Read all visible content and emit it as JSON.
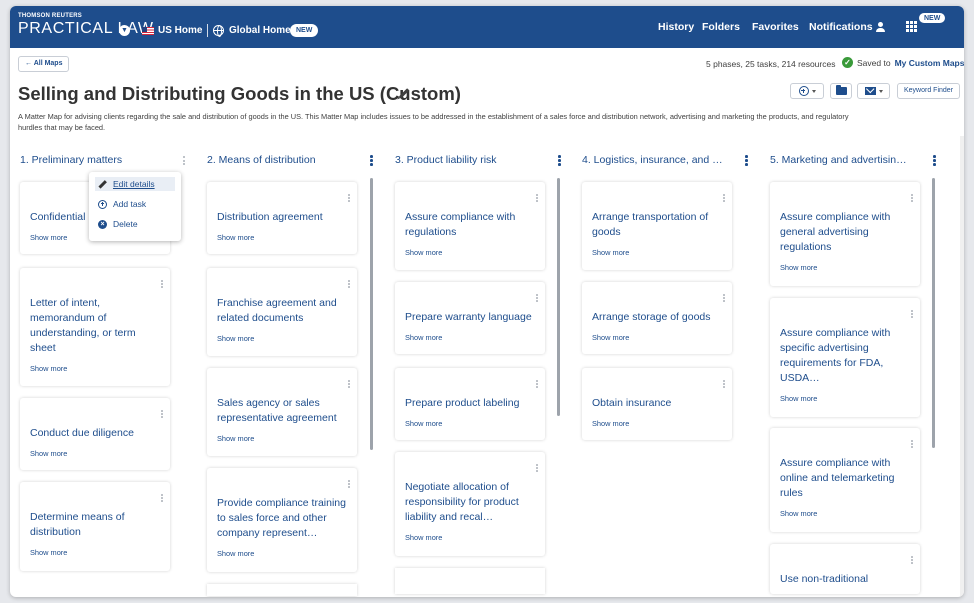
{
  "header": {
    "brand_top": "THOMSON REUTERS",
    "brand_main": "PRACTICAL LAW",
    "us_home": "US Home",
    "global_home": "Global Home",
    "new_badge": "NEW",
    "menu": [
      "History",
      "Folders",
      "Favorites",
      "Notifications"
    ],
    "apps_badge": "NEW",
    "bar_color": "#1e4d8c"
  },
  "toolbar": {
    "back_label": "All Maps",
    "summary": "5 phases, 25 tasks, 214 resources",
    "saved_prefix": "Saved to",
    "saved_target": "My Custom Maps",
    "keyword_finder": "Keyword Finder"
  },
  "page": {
    "title": "Selling and Distributing Goods in the US (Custom)",
    "description": "A Matter Map for advising clients regarding the sale and distribution of goods in the US. This Matter Map includes issues to be addressed in the establishment of a sales force and distribution network, advertising and marketing the products, and regulatory hurdles that may be faced."
  },
  "show_more": "Show more",
  "context_menu": {
    "edit": "Edit details",
    "add": "Add task",
    "delete": "Delete"
  },
  "columns": [
    {
      "title": "1. Preliminary matters",
      "cards": [
        "Confidential",
        "Letter of intent, memorandum of understanding, or term sheet",
        "Conduct due diligence",
        "Determine means of distribution"
      ]
    },
    {
      "title": "2. Means of distribution",
      "cards": [
        "Distribution agreement",
        "Franchise agreement and related documents",
        "Sales agency or sales representative agreement",
        "Provide compliance training to sales force and other company represent…"
      ]
    },
    {
      "title": "3. Product liability risk",
      "cards": [
        "Assure compliance with regulations",
        "Prepare warranty language",
        "Prepare product labeling",
        "Negotiate allocation of responsibility for product liability and recal…"
      ]
    },
    {
      "title": "4. Logistics, insurance, and …",
      "cards": [
        "Arrange transportation of goods",
        "Arrange storage of goods",
        "Obtain insurance"
      ]
    },
    {
      "title": "5. Marketing and advertisin…",
      "cards": [
        "Assure compliance with general advertising regulations",
        "Assure compliance with specific advertising requirements for FDA, USDA…",
        "Assure compliance with online and telemarketing rules",
        "Use non-traditional"
      ]
    }
  ]
}
